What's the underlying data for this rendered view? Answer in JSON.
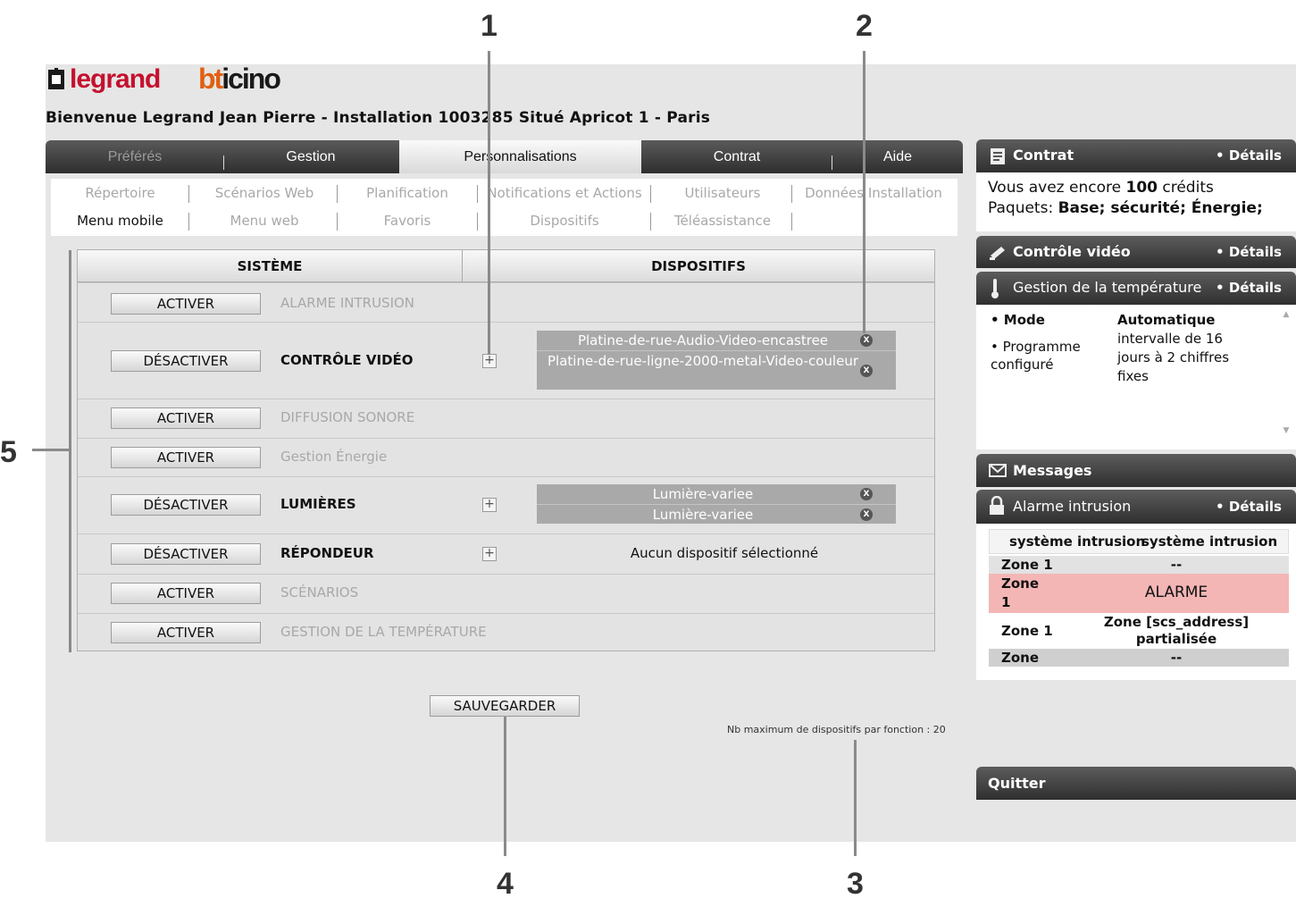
{
  "brand": {
    "legrand": "legrand",
    "bticino_b": "bt",
    "bticino_r": "icino"
  },
  "welcome": "Bienvenue Legrand Jean Pierre - Installation 1003285 Situé Apricot 1 - Paris",
  "callouts": {
    "c1": "1",
    "c2": "2",
    "c3": "3",
    "c4": "4",
    "c5": "5"
  },
  "main_tabs": [
    {
      "label": "Préférés"
    },
    {
      "label": "Gestion"
    },
    {
      "label": "Personnalisations"
    },
    {
      "label": "Contrat"
    },
    {
      "label": "Aide"
    }
  ],
  "sub_tabs": {
    "row1": [
      "Répertoire",
      "Scénarios Web",
      "Planification",
      "Notifications et Actions",
      "Utilisateurs",
      "Données Installation"
    ],
    "row2": [
      "Menu mobile",
      "Menu web",
      "Favoris",
      "Dispositifs",
      "Téléassistance"
    ]
  },
  "table": {
    "col_system": "SISTÈME",
    "col_devices": "DISPOSITIFS",
    "rows": [
      {
        "button": "ACTIVER",
        "name": "ALARME INTRUSION"
      },
      {
        "button": "DÉSACTIVER",
        "name": "CONTRÔLE VIDÉO",
        "devices": [
          "Platine-de-rue-Audio-Video-encastree",
          "Platine-de-rue-ligne-2000-metal-Video-couleur"
        ]
      },
      {
        "button": "ACTIVER",
        "name": "DIFFUSION SONORE"
      },
      {
        "button": "ACTIVER",
        "name": "Gestion Énergie"
      },
      {
        "button": "DÉSACTIVER",
        "name": "LUMIÈRES",
        "devices": [
          "Lumière-variee",
          "Lumière-variee"
        ]
      },
      {
        "button": "DÉSACTIVER",
        "name": "RÉPONDEUR",
        "no_device": "Aucun dispositif sélectionné"
      },
      {
        "button": "ACTIVER",
        "name": "SCÉNARIOS"
      },
      {
        "button": "ACTIVER",
        "name": "GESTION DE LA TEMPÉRATURE"
      }
    ]
  },
  "save_label": "SAUVEGARDER",
  "max_note": "Nb maximum de dispositifs par fonction : 20",
  "widgets": {
    "contrat": {
      "title": "Contrat",
      "details": "• Détails",
      "line1_pre": "Vous avez encore ",
      "line1_num": "100",
      "line1_post": " crédits",
      "line2_pre": "Paquets: ",
      "line2_val": "Base; sécurité; Énergie;"
    },
    "video": {
      "title": "Contrôle vidéo",
      "details": "• Détails"
    },
    "temp": {
      "title": "Gestion de la température",
      "details": "• Détails",
      "mode_label": "• Mode",
      "mode_value": "Automatique",
      "prog_label": "• Programme configuré",
      "prog_value": "intervalle de 16 jours à 2 chiffres fixes"
    },
    "messages": {
      "title": "Messages"
    },
    "alarm": {
      "title": "Alarme intrusion",
      "details": "• Détails",
      "head_a": "système intrusion",
      "head_b": "système intrusion",
      "rows": [
        {
          "zone": "Zone 1",
          "value": "--"
        },
        {
          "zone": "Zone 1",
          "value": "ALARME"
        },
        {
          "zone": "Zone 1",
          "value": "Zone [scs_address] partialisée"
        },
        {
          "zone": "Zone",
          "value": "--"
        }
      ]
    },
    "quit": {
      "title": "Quitter"
    }
  }
}
